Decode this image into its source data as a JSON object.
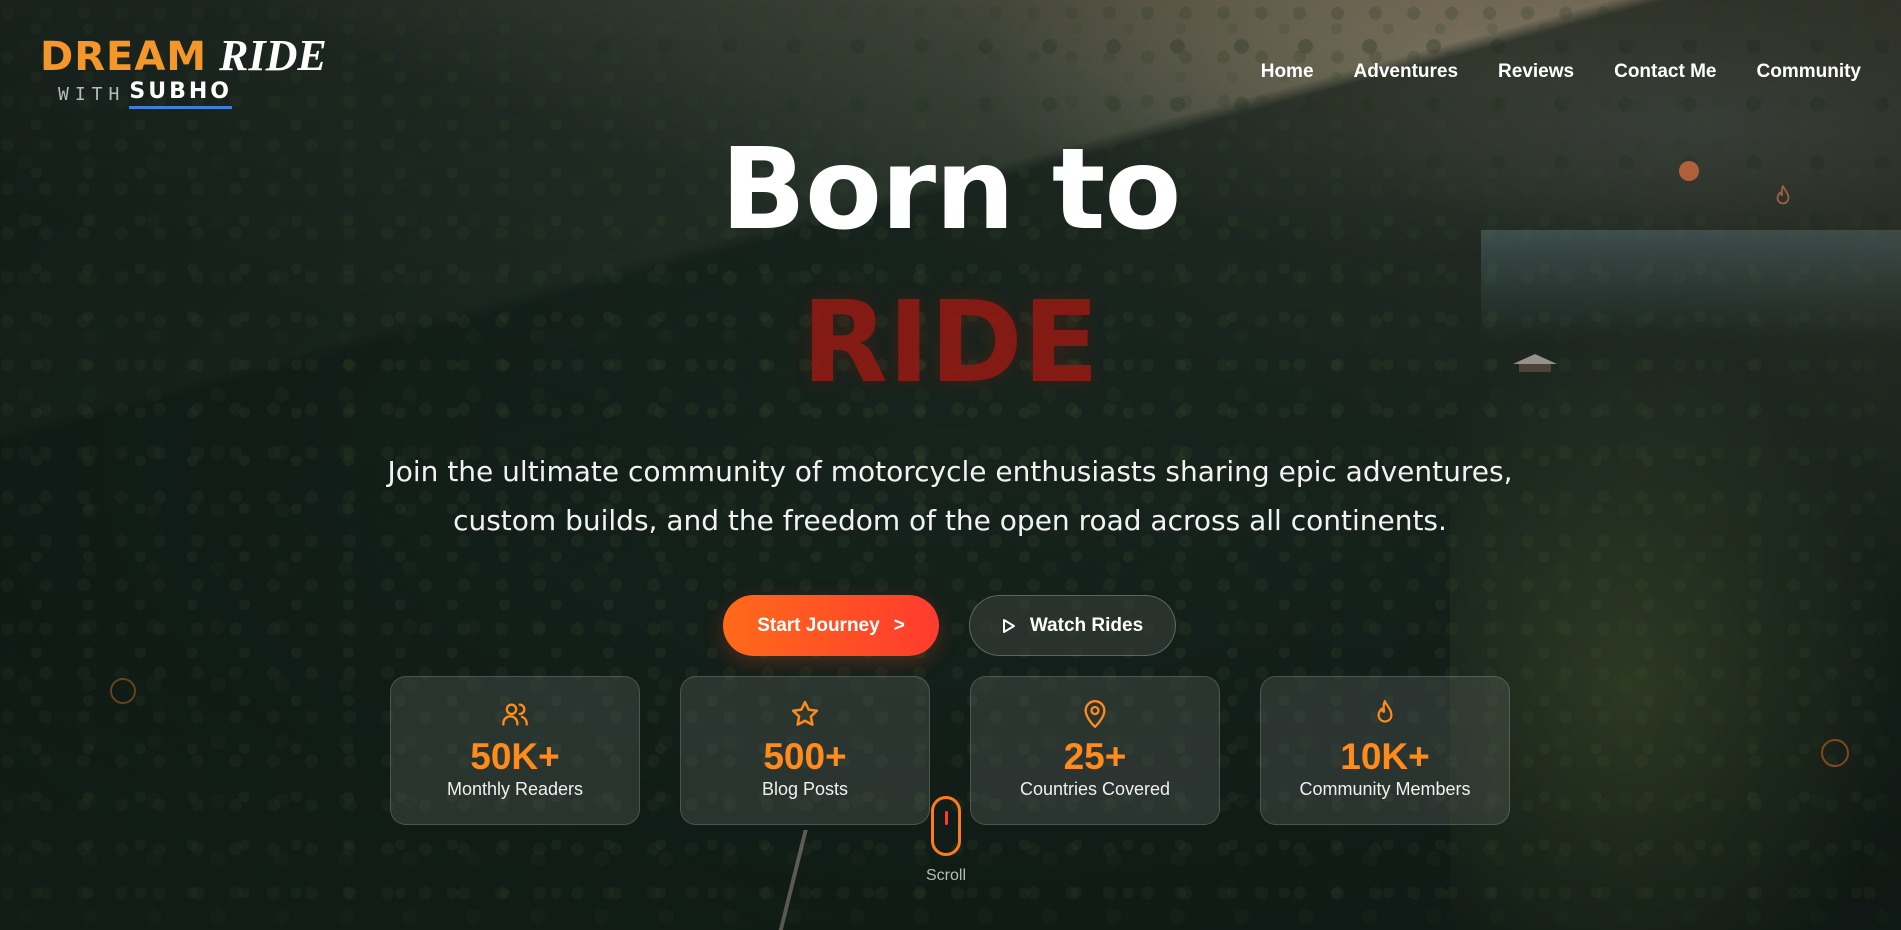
{
  "brand": {
    "line1_a": "DREAM",
    "line1_b": "RIDE",
    "line2_a": "WITH",
    "line2_b": "SUBHO"
  },
  "nav": {
    "items": [
      "Home",
      "Adventures",
      "Reviews",
      "Contact Me",
      "Community"
    ]
  },
  "hero": {
    "title_line1": "Born to",
    "title_line2": "RIDE",
    "subtitle": "Join the ultimate community of motorcycle enthusiasts sharing epic adventures, custom builds, and the freedom of the open road across all continents."
  },
  "buttons": {
    "primary_label": "Start Journey",
    "primary_arrow": ">",
    "secondary_label": "Watch Rides",
    "secondary_icon": "play-icon"
  },
  "stats": [
    {
      "icon": "users-icon",
      "value": "50K+",
      "label": "Monthly Readers"
    },
    {
      "icon": "star-icon",
      "value": "500+",
      "label": "Blog Posts"
    },
    {
      "icon": "map-pin-icon",
      "value": "25+",
      "label": "Countries Covered"
    },
    {
      "icon": "flame-icon",
      "value": "10K+",
      "label": "Community Members"
    }
  ],
  "scroll": {
    "label": "Scroll"
  },
  "colors": {
    "accent_orange": "#ff8c1a",
    "primary_gradient_start": "#ff6a1a",
    "primary_gradient_end": "#ff3b2e",
    "ride_red": "#8e1a14",
    "underline_blue": "#3d7fd9"
  }
}
